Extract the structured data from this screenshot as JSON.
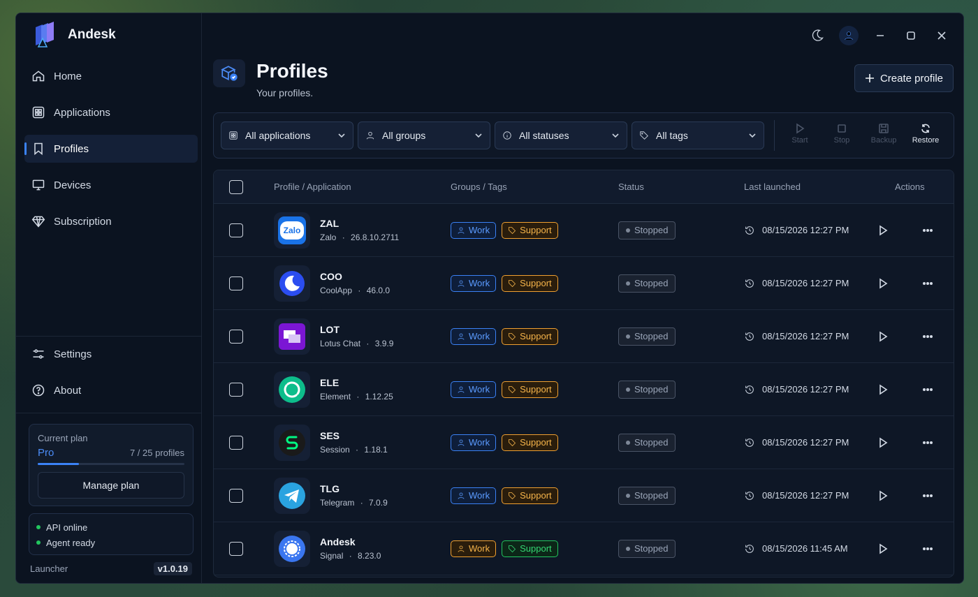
{
  "app": {
    "name": "Andesk"
  },
  "nav": {
    "items": [
      {
        "label": "Home",
        "icon": "home-icon"
      },
      {
        "label": "Applications",
        "icon": "grid-icon"
      },
      {
        "label": "Profiles",
        "icon": "bookmark-icon"
      },
      {
        "label": "Devices",
        "icon": "monitor-icon"
      },
      {
        "label": "Subscription",
        "icon": "diamond-icon"
      }
    ],
    "bottom": [
      {
        "label": "Settings",
        "icon": "sliders-icon"
      },
      {
        "label": "About",
        "icon": "help-icon"
      }
    ]
  },
  "plan": {
    "label": "Current plan",
    "name": "Pro",
    "count": "7 / 25 profiles",
    "used": 7,
    "total": 25,
    "manage_label": "Manage plan"
  },
  "system_status": {
    "api": "API online",
    "agent": "Agent ready"
  },
  "footer": {
    "label": "Launcher",
    "version": "v1.0.19"
  },
  "header": {
    "title": "Profiles",
    "subtitle": "Your profiles.",
    "create_label": "Create profile"
  },
  "filters": {
    "applications": "All applications",
    "groups": "All groups",
    "statuses": "All statuses",
    "tags": "All tags"
  },
  "actions": {
    "start": "Start",
    "stop": "Stop",
    "backup": "Backup",
    "restore": "Restore"
  },
  "table": {
    "columns": {
      "profile": "Profile / Application",
      "groups": "Groups / Tags",
      "status": "Status",
      "last": "Last launched",
      "actions": "Actions"
    },
    "rows": [
      {
        "name": "ZAL",
        "app": "Zalo",
        "version": "26.8.10.2711",
        "sep": "·",
        "tag1": "Work",
        "tag2": "Support",
        "status": "Stopped",
        "last": "08/15/2026 12:27 PM"
      },
      {
        "name": "COO",
        "app": "CoolApp",
        "version": "46.0.0",
        "sep": "·",
        "tag1": "Work",
        "tag2": "Support",
        "status": "Stopped",
        "last": "08/15/2026 12:27 PM"
      },
      {
        "name": "LOT",
        "app": "Lotus Chat",
        "version": "3.9.9",
        "sep": "·",
        "tag1": "Work",
        "tag2": "Support",
        "status": "Stopped",
        "last": "08/15/2026 12:27 PM"
      },
      {
        "name": "ELE",
        "app": "Element",
        "version": "1.12.25",
        "sep": "·",
        "tag1": "Work",
        "tag2": "Support",
        "status": "Stopped",
        "last": "08/15/2026 12:27 PM"
      },
      {
        "name": "SES",
        "app": "Session",
        "version": "1.18.1",
        "sep": "·",
        "tag1": "Work",
        "tag2": "Support",
        "status": "Stopped",
        "last": "08/15/2026 12:27 PM"
      },
      {
        "name": "TLG",
        "app": "Telegram",
        "version": "7.0.9",
        "sep": "·",
        "tag1": "Work",
        "tag2": "Support",
        "status": "Stopped",
        "last": "08/15/2026 12:27 PM"
      },
      {
        "name": "Andesk",
        "app": "Signal",
        "version": "8.23.0",
        "sep": "·",
        "tag1": "Work",
        "tag2": "Support",
        "status": "Stopped",
        "last": "08/15/2026 11:45 AM"
      }
    ]
  },
  "icon_text": {
    "zalo": "Zalo"
  },
  "colors": {
    "accent": "#3b82f6",
    "work": "#5b9bff",
    "support": "#f6b44a",
    "green": "#22c55e"
  }
}
